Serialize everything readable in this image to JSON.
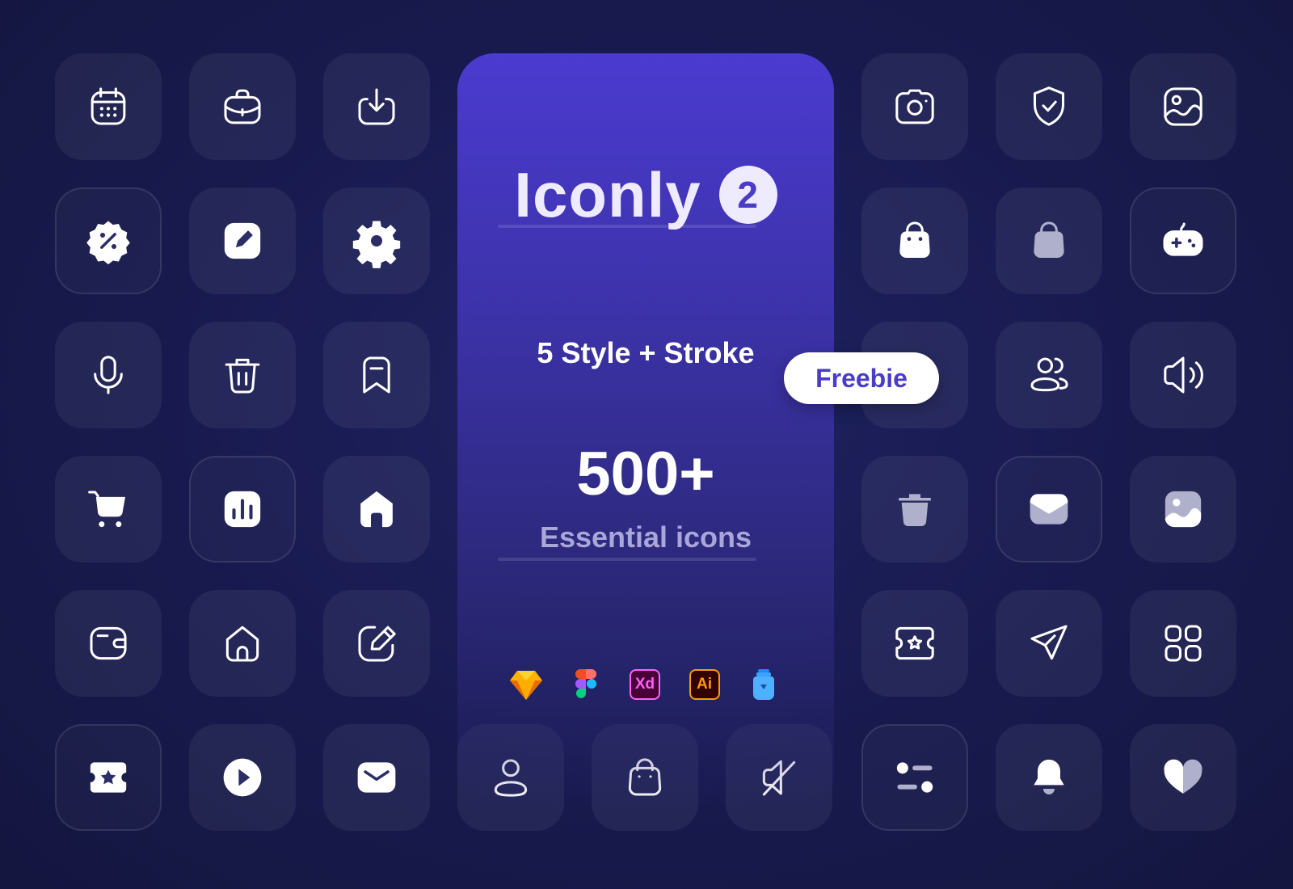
{
  "card": {
    "brand": "Iconly",
    "version_badge": "2",
    "tagline": "5 Style + Stroke",
    "count": "500+",
    "subtitle": "Essential icons",
    "tools": [
      "sketch-icon",
      "figma-icon",
      "xd-icon",
      "illustrator-icon",
      "iconjar-icon"
    ],
    "xd_label": "Xd",
    "ai_label": "Ai"
  },
  "freebie_label": "Freebie",
  "colors": {
    "background": "#181a4e",
    "card_top": "#4b3bd0",
    "accent": "#4a3cc8",
    "tile": "rgba(255,255,255,0.06)"
  },
  "icons": [
    "calendar-icon",
    "briefcase-icon",
    "download-icon",
    "discount-icon",
    "edit-icon",
    "setting-icon",
    "voice-icon",
    "delete-icon",
    "bookmark-icon",
    "buy-icon",
    "chart-icon",
    "home-icon",
    "wallet-icon",
    "home-outline-icon",
    "edit-square-icon",
    "ticket-star-icon",
    "play-icon",
    "message-icon",
    "profile-icon",
    "bag-icon",
    "volume-off-icon",
    "camera-icon",
    "shield-done-icon",
    "image-icon",
    "bag-filled-icon",
    "bag-2-icon",
    "game-icon",
    "users-icon",
    "volume-up-icon",
    "delete-filled-icon",
    "message-filled-icon",
    "image-filled-icon",
    "ticket-star-outline-icon",
    "send-icon",
    "category-icon",
    "filter-icon",
    "notification-icon",
    "heart-icon"
  ]
}
